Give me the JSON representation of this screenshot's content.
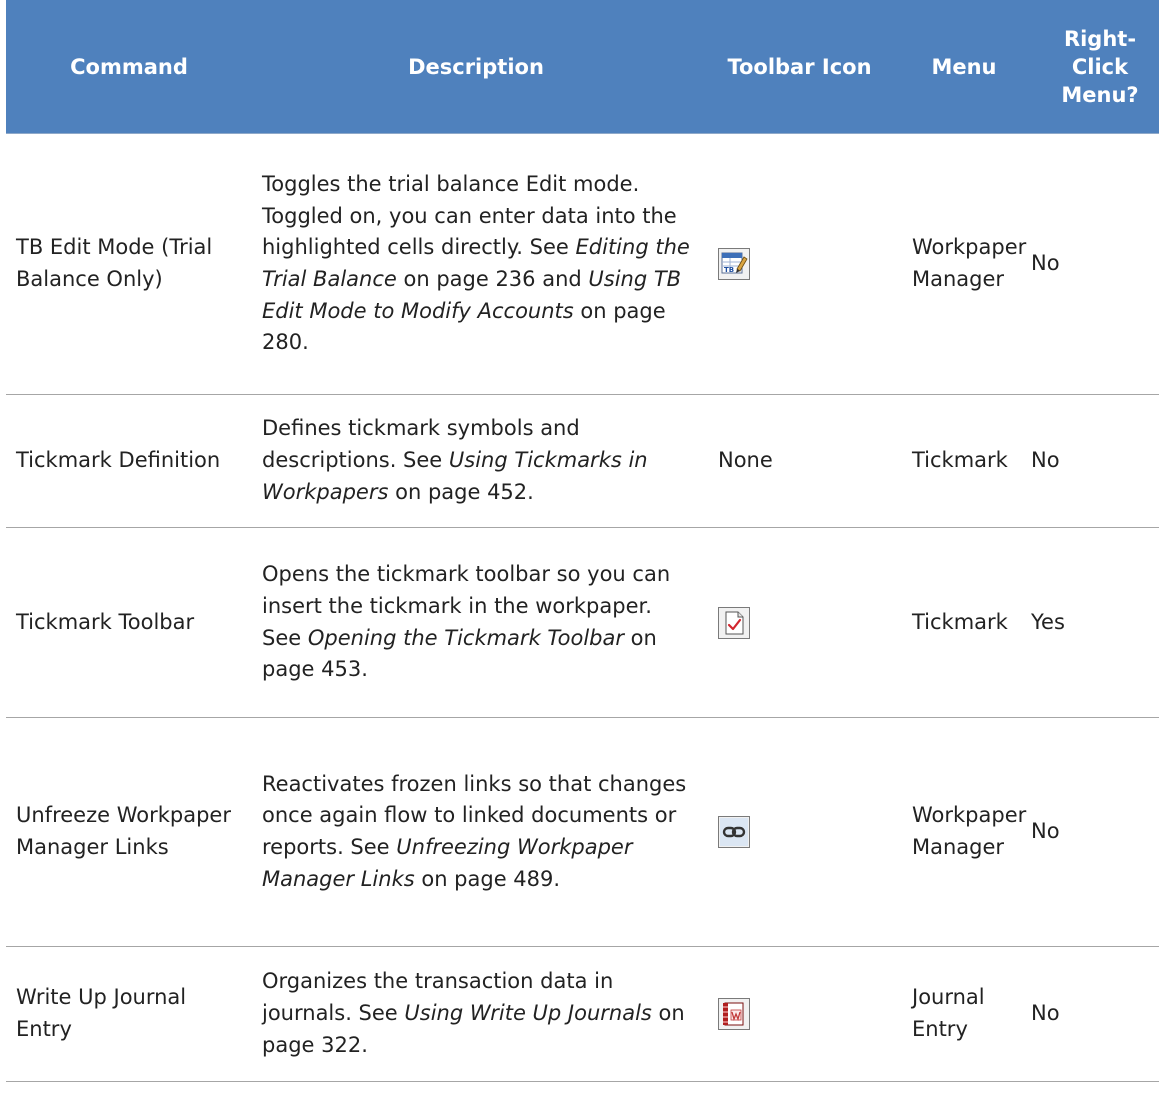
{
  "table": {
    "headers": [
      "Command",
      "Description",
      "Toolbar Icon",
      "Menu",
      "Right-Click Menu?"
    ],
    "rows": [
      {
        "command": "TB Edit Mode (Trial Balance Only)",
        "desc_prefix": "Toggles the trial balance Edit mode. Toggled on, you can enter data into the highlighted cells directly. See ",
        "link1": "Editing the Trial Balance",
        "mid1": " on page 236 and ",
        "link2": "Using TB Edit Mode to Modify Accounts",
        "tail": " on page 280.",
        "icon": "tb-edit-icon",
        "toolbar_text": "",
        "menu": "Workpaper Manager",
        "right_click": "No"
      },
      {
        "command": "Tickmark Definition",
        "desc_prefix": "Defines tickmark symbols and descriptions. See ",
        "link1": "Using Tickmarks in Workpapers",
        "tail": " on page 452.",
        "icon": "",
        "toolbar_text": "None",
        "menu": "Tickmark",
        "right_click": "No"
      },
      {
        "command": "Tickmark Toolbar",
        "desc_prefix": "Opens the tickmark toolbar so you can insert the tickmark in the workpaper. See ",
        "link1": "Opening the Tickmark Toolbar",
        "tail": " on page 453.",
        "icon": "tickmark-icon",
        "toolbar_text": "",
        "menu": "Tickmark",
        "right_click": "Yes"
      },
      {
        "command": "Unfreeze Workpaper Manager Links",
        "desc_prefix": "Reactivates frozen links so that changes once again flow to linked documents or reports. See ",
        "link1": "Unfreezing Workpaper Manager Links",
        "tail": " on page 489.",
        "icon": "link-icon",
        "toolbar_text": "",
        "menu": "Workpaper Manager",
        "right_click": "No"
      },
      {
        "command": "Write Up Journal Entry",
        "desc_prefix": "Organizes the transaction data in journals. See ",
        "link1": "Using Write Up Journals",
        "tail": " on page 322.",
        "icon": "journal-entry-icon",
        "toolbar_text": "",
        "menu": "Journal Entry",
        "right_click": "No"
      }
    ]
  }
}
